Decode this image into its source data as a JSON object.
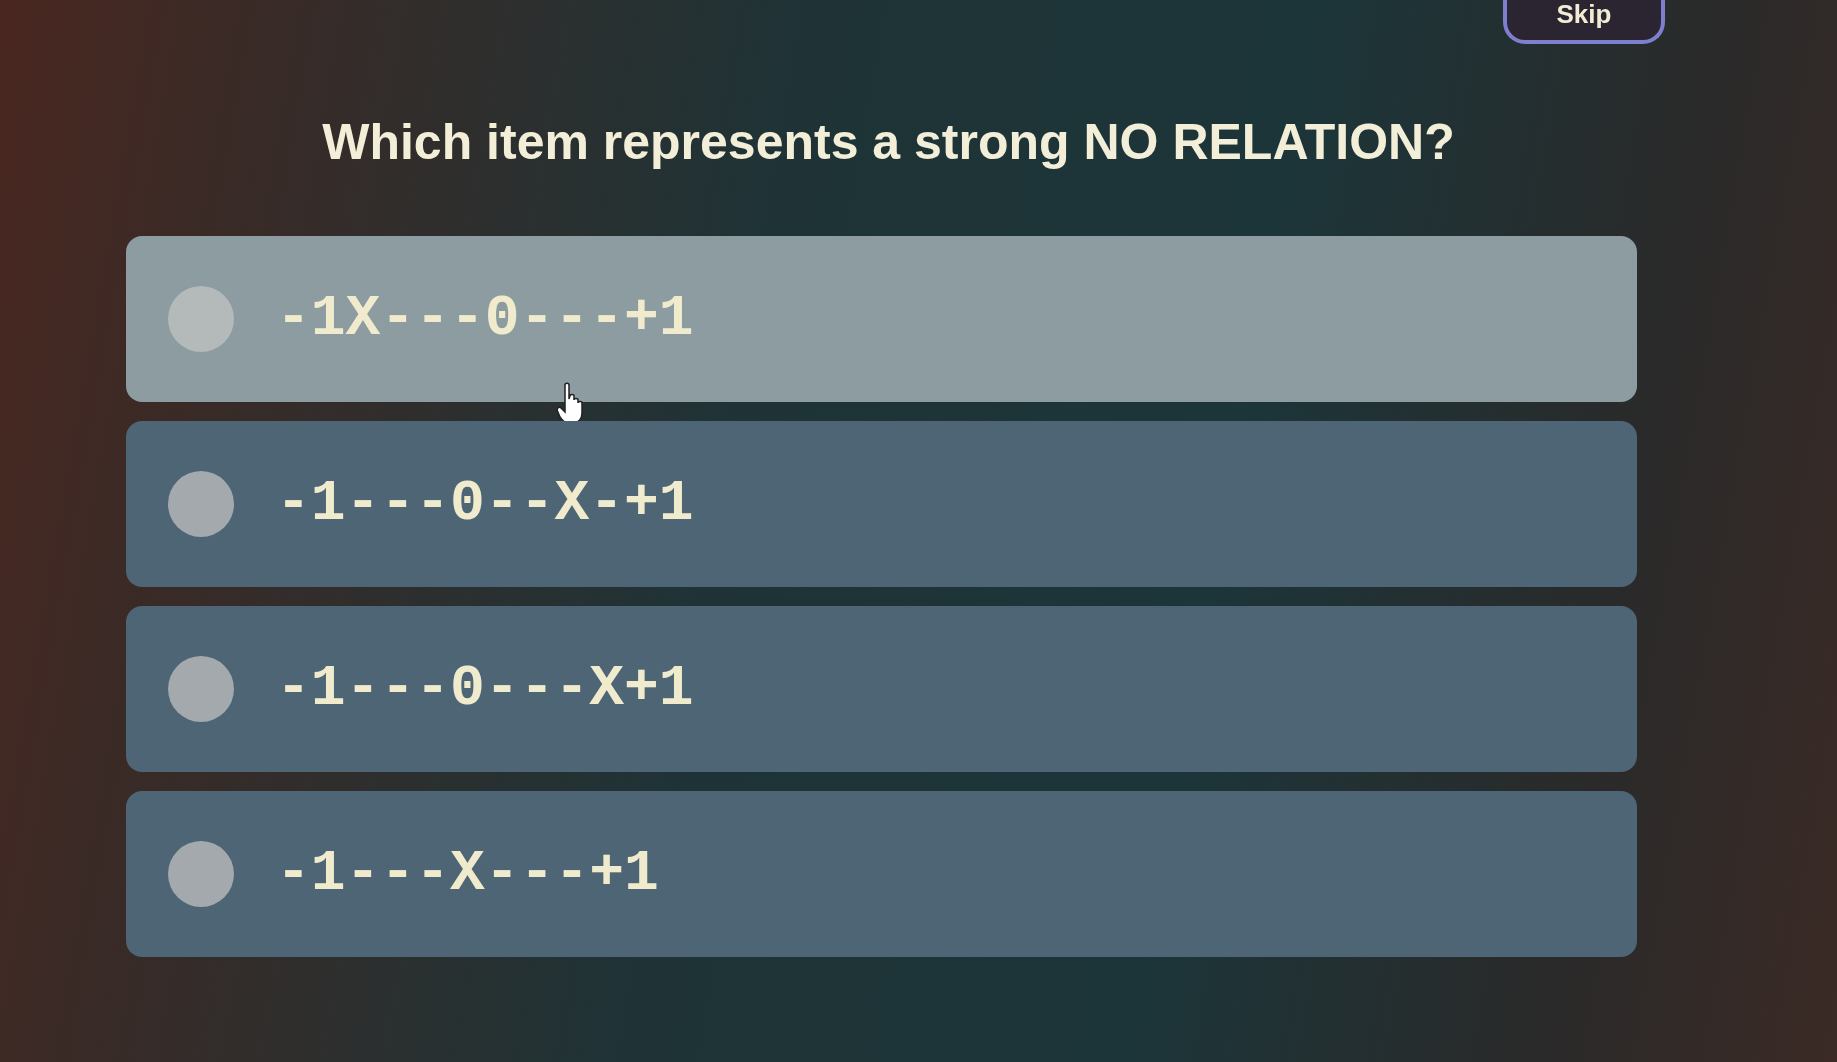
{
  "skip_button": {
    "label": "Skip"
  },
  "question": "Which item represents a strong NO RELATION?",
  "options": [
    {
      "label": "-1X---0---+1",
      "hovered": true,
      "selected": false
    },
    {
      "label": "-1---0--X-+1",
      "hovered": false,
      "selected": false
    },
    {
      "label": "-1---0---X+1",
      "hovered": false,
      "selected": false
    },
    {
      "label": "-1---X---+1",
      "hovered": false,
      "selected": false
    }
  ]
}
